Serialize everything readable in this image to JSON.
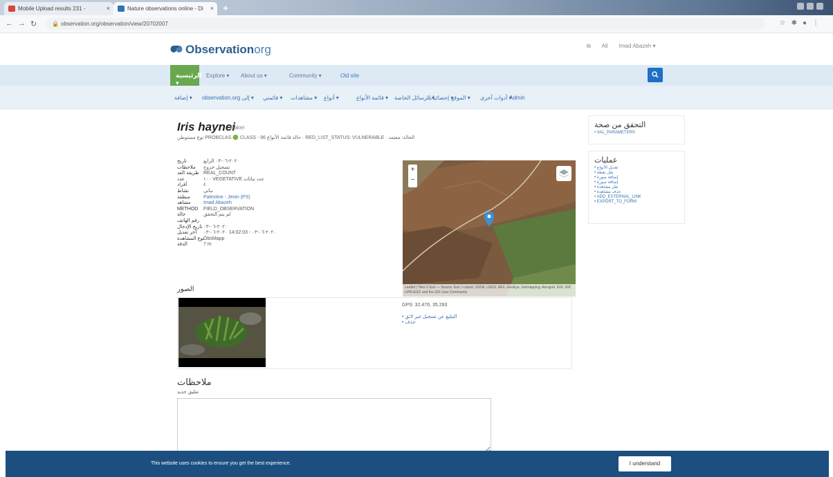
{
  "browser": {
    "tabs": [
      {
        "title": "Mobile Upload results 231 - ",
        "close": "×"
      },
      {
        "title": "Nature observations online - Di",
        "close": "×"
      }
    ],
    "new_tab": "+",
    "url": "observation.org/observation/view/20702007"
  },
  "header": {
    "logo_main": "Observation",
    "logo_org": "org",
    "right_links": [
      "All",
      "Imad Abazeh ▾"
    ]
  },
  "nav_primary": {
    "home": "الرئيسية ▾",
    "items": [
      "Explore ▾",
      "About us ▾",
      "Community ▾",
      "Old site"
    ],
    "search_icon": "magnifier"
  },
  "nav_secondary": {
    "items": [
      "إضافة ▾",
      "observation.org إلى ▾",
      "قائمتي ▾",
      "مشاهدات ▾",
      "أنواع ▾",
      "قائمة الأنواع ▾",
      "الرسائل الخاصة ▾",
      "إحصائيات ▾",
      "الموقع ▾",
      "أدوات أخرى ▾",
      "Admin"
    ]
  },
  "observation": {
    "species": "Iris haynei",
    "author": "Baker",
    "meta_line": "نوع مستوطن PROBCLAS 🟢 CLASS - 96  حالة قائمة الأنواع  ·  RED_LIST_STATUS: VULNERABLE  ·  الحالة: معتمد",
    "fields": [
      {
        "k": "تاريخ",
        "v": "٢٠٢٠-٠٦-٠٣ الرابع",
        "link": false
      },
      {
        "k": "ملاحظات",
        "v": "تسجيل خروج",
        "link": false
      },
      {
        "k": "طريقة العد",
        "v": "REAL_COUNT",
        "link": false
      },
      {
        "k": "عدد",
        "v": "١٠٠ VEGETATIVE عدد نباتات",
        "link": false
      },
      {
        "k": "أفراد",
        "v": "٤",
        "link": false
      },
      {
        "k": "نشاط",
        "v": "نباتي",
        "link": false
      },
      {
        "k": "منطقة",
        "v": "Palestine - Jenin (PS)",
        "link": true
      },
      {
        "k": "مشاهد",
        "v": "Imad Abazeh",
        "link": true
      },
      {
        "k": "METHOD",
        "v": "FIELD_OBSERVATION",
        "link": false
      },
      {
        "k": "حالة",
        "v": "لم يتم التحقق",
        "link": false
      },
      {
        "k": "رقم الهاتف",
        "v": "",
        "link": false
      },
      {
        "k": "تاريخ الإدخال",
        "v": "٢٠٢٠-٠٦-٠٣",
        "link": false
      },
      {
        "k": "آخر تعديل",
        "v": "٢٠٢٠-٠٦-٠٣ 14:02:03 - ٢٠٢٠-٠٦-٠٣",
        "link": false
      },
      {
        "k": "نوع المشاهدة",
        "v": "ObsMapp",
        "link": false
      },
      {
        "k": "الدقة",
        "v": "7 m",
        "link": false
      }
    ],
    "map_attribution": "Leaflet | Tiles © Esri — Source: Esri, i-cubed, USDA, USGS, AEX, GeoEye, Getmapping, Aerogrid, IGN, IGP, UPR-EGP, and the GIS User Community",
    "zoom_in": "+",
    "zoom_out": "−",
    "photos_heading": "الصور",
    "coords": "GPS: 32.476, 35.293",
    "photo_links": [
      "التبليغ عن تسجيل غير لائق",
      "حذف"
    ],
    "comments_heading": "ملاحظات",
    "comments_sub": "تعليق جديد"
  },
  "sidebar": {
    "verify_heading": "التحقق من صحة",
    "verify_items": [
      "VAL_PARAMETERS"
    ],
    "actions_heading": "عمليات",
    "action_items": [
      "تعديل الأنواع",
      "نقل نقطة",
      "إضافة صورة",
      "إضافة صورة",
      "نقل مشاهدة",
      "حذف مشاهدة",
      "ADD_EXTERNAL_LINK",
      "EXPORT_TO_FORM"
    ]
  },
  "cookie": {
    "message": "This website uses cookies to ensure you get the best experience.",
    "button": "I understand"
  },
  "colors": {
    "nav_green": "#6aa84f",
    "nav_blue": "#dde9f5",
    "brand_blue": "#2c5e8f",
    "cookie_bar": "#1c4f80",
    "link": "#3b72b0"
  }
}
